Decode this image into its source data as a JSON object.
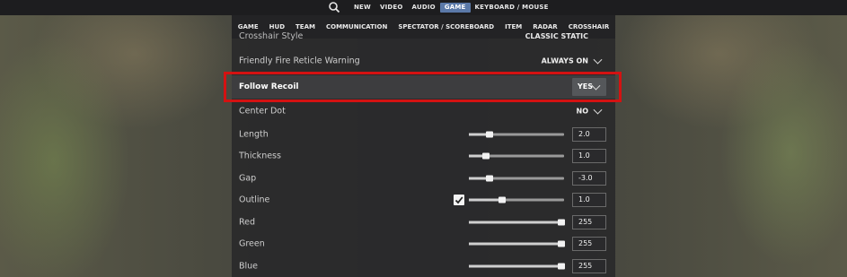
{
  "topnav": {
    "items": [
      "NEW",
      "VIDEO",
      "AUDIO",
      "GAME",
      "KEYBOARD / MOUSE"
    ],
    "active": "GAME"
  },
  "subnav": {
    "items": [
      "GAME",
      "HUD",
      "TEAM",
      "COMMUNICATION",
      "SPECTATOR / SCOREBOARD",
      "ITEM",
      "RADAR",
      "CROSSHAIR"
    ]
  },
  "settings": {
    "crosshair_style": {
      "label": "Crosshair Style",
      "value": "CLASSIC STATIC"
    },
    "friendly_fire": {
      "label": "Friendly Fire Reticle Warning",
      "value": "ALWAYS ON"
    },
    "follow_recoil": {
      "label": "Follow Recoil",
      "value": "YES"
    },
    "center_dot": {
      "label": "Center Dot",
      "value": "NO"
    },
    "length": {
      "label": "Length",
      "value": "2.0",
      "level": 0.22
    },
    "thickness": {
      "label": "Thickness",
      "value": "1.0",
      "level": 0.18
    },
    "gap": {
      "label": "Gap",
      "value": "-3.0",
      "level": 0.22
    },
    "outline": {
      "label": "Outline",
      "value": "1.0",
      "level": 0.35,
      "checked": true
    },
    "red": {
      "label": "Red",
      "value": "255",
      "level": 0.97
    },
    "green": {
      "label": "Green",
      "value": "255",
      "level": 0.97
    },
    "blue": {
      "label": "Blue",
      "value": "255",
      "level": 0.97
    }
  },
  "colors": {
    "highlight": "#d41212",
    "active_tab": "#5b79a8"
  },
  "icons": {
    "search": "search-icon",
    "chevron": "chevron-down-icon",
    "check": "check-icon"
  }
}
